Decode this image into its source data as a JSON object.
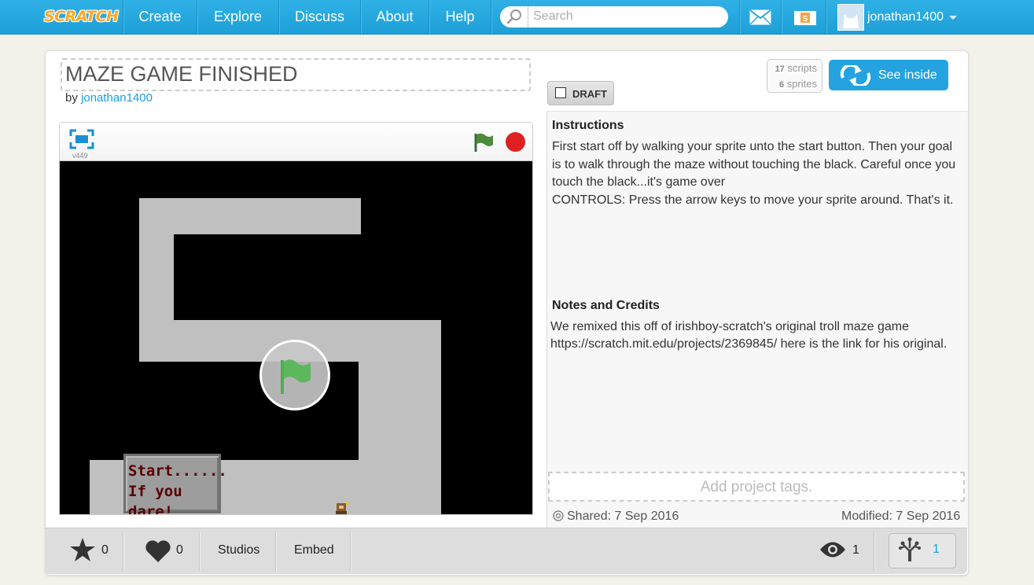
{
  "nav": {
    "logo": "SCRATCH",
    "links": [
      "Create",
      "Explore",
      "Discuss",
      "About",
      "Help"
    ],
    "search_placeholder": "Search",
    "username": "jonathan1400"
  },
  "project": {
    "title": "MAZE GAME FINISHED",
    "by_label": "by",
    "author": "jonathan1400",
    "draft_label": "DRAFT",
    "scripts_count": "17",
    "scripts_label": "scripts",
    "sprites_count": "6",
    "sprites_label": "sprites",
    "see_inside": "See inside"
  },
  "player": {
    "version": "v449",
    "start_button_line1": "Start......",
    "start_button_line2": "If you dare!"
  },
  "info": {
    "instructions_heading": "Instructions",
    "instructions": "First start off by walking your sprite unto the start button. Then your goal is to walk through the maze without touching the black. Careful once you touch the black...it's game over\nCONTROLS: Press the arrow keys to move your sprite around. That's it.",
    "notes_heading": "Notes and Credits",
    "notes": "We remixed this off of irishboy-scratch's original troll maze game\nhttps://scratch.mit.edu/projects/2369845/ here is the link for his original.",
    "tags_placeholder": "Add project tags.",
    "shared": "Shared: 7 Sep 2016",
    "modified": "Modified: 7 Sep 2016"
  },
  "bottom": {
    "loves": "0",
    "favorites": "0",
    "studios": "Studios",
    "embed": "Embed",
    "views": "1",
    "remixes": "1"
  },
  "colors": {
    "nav_blue": "#25aae1",
    "link_blue": "#1a9fdb",
    "maze_gray": "#c0c0c0",
    "stop_red": "#e02020",
    "flag_green": "#4caf50"
  }
}
